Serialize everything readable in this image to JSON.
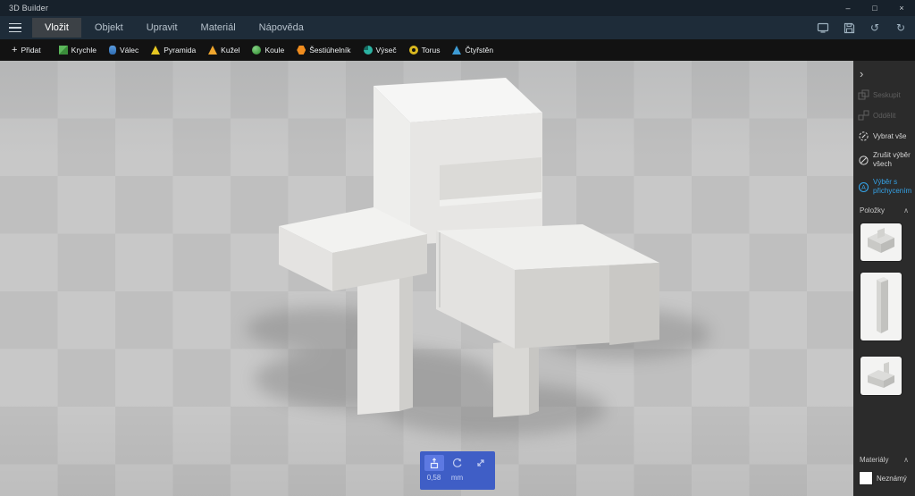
{
  "titlebar": {
    "app_title": "3D Builder"
  },
  "icons": {
    "chevron_right": "›",
    "chevron_up": "∧",
    "undo": "↺",
    "redo": "↻",
    "minimize": "–",
    "maximize": "□",
    "close": "×",
    "add": "+",
    "snap_badge": "A"
  },
  "menubar": {
    "tabs": [
      {
        "label": "Vložit",
        "selected": true
      },
      {
        "label": "Objekt",
        "selected": false
      },
      {
        "label": "Upravit",
        "selected": false
      },
      {
        "label": "Materiál",
        "selected": false
      },
      {
        "label": "Nápověda",
        "selected": false
      }
    ]
  },
  "toolbar": {
    "add_label": "Přidat",
    "shapes": [
      {
        "label": "Krychle",
        "icon": "cube-icon",
        "color": "#4ca64c"
      },
      {
        "label": "Válec",
        "icon": "cylinder-icon",
        "color": "#3b7cd9"
      },
      {
        "label": "Pyramida",
        "icon": "pyramid-icon",
        "color": "#e6c722"
      },
      {
        "label": "Kužel",
        "icon": "cone-icon",
        "color": "#f0a62e"
      },
      {
        "label": "Koule",
        "icon": "sphere-icon",
        "color": "#49a845"
      },
      {
        "label": "Šestiúhelník",
        "icon": "hexagon-icon",
        "color": "#f08c1e"
      },
      {
        "label": "Výseč",
        "icon": "wedge-icon",
        "color": "#2bb3a3"
      },
      {
        "label": "Torus",
        "icon": "torus-icon",
        "color": "#d9b81f"
      },
      {
        "label": "Čtyřstěn",
        "icon": "tetrahedron-icon",
        "color": "#3d9bd4"
      }
    ]
  },
  "sidebar": {
    "actions": [
      {
        "label": "Seskupit",
        "state": "disabled"
      },
      {
        "label": "Oddělit",
        "state": "disabled"
      },
      {
        "label": "Vybrat vše",
        "state": "normal"
      },
      {
        "label": "Zrušit výběr všech",
        "state": "normal"
      },
      {
        "label": "Výběr s přichycením",
        "state": "active"
      }
    ],
    "items_header": "Položky",
    "materials_header": "Materiály",
    "material_name": "Neznámý"
  },
  "status_panel": {
    "value": "0,58",
    "unit": "mm"
  },
  "colors": {
    "menubar_bg": "#1e2c39",
    "toolbar_bg": "#121212",
    "sidebar_bg": "#2b2b2b",
    "selected_tab_bg": "#3c4146",
    "snap_blue": "#35a3e8",
    "panel_blue": "#3f5ec6",
    "viewport_light": "#c8c8c8",
    "viewport_dark": "#bfbfbf"
  }
}
